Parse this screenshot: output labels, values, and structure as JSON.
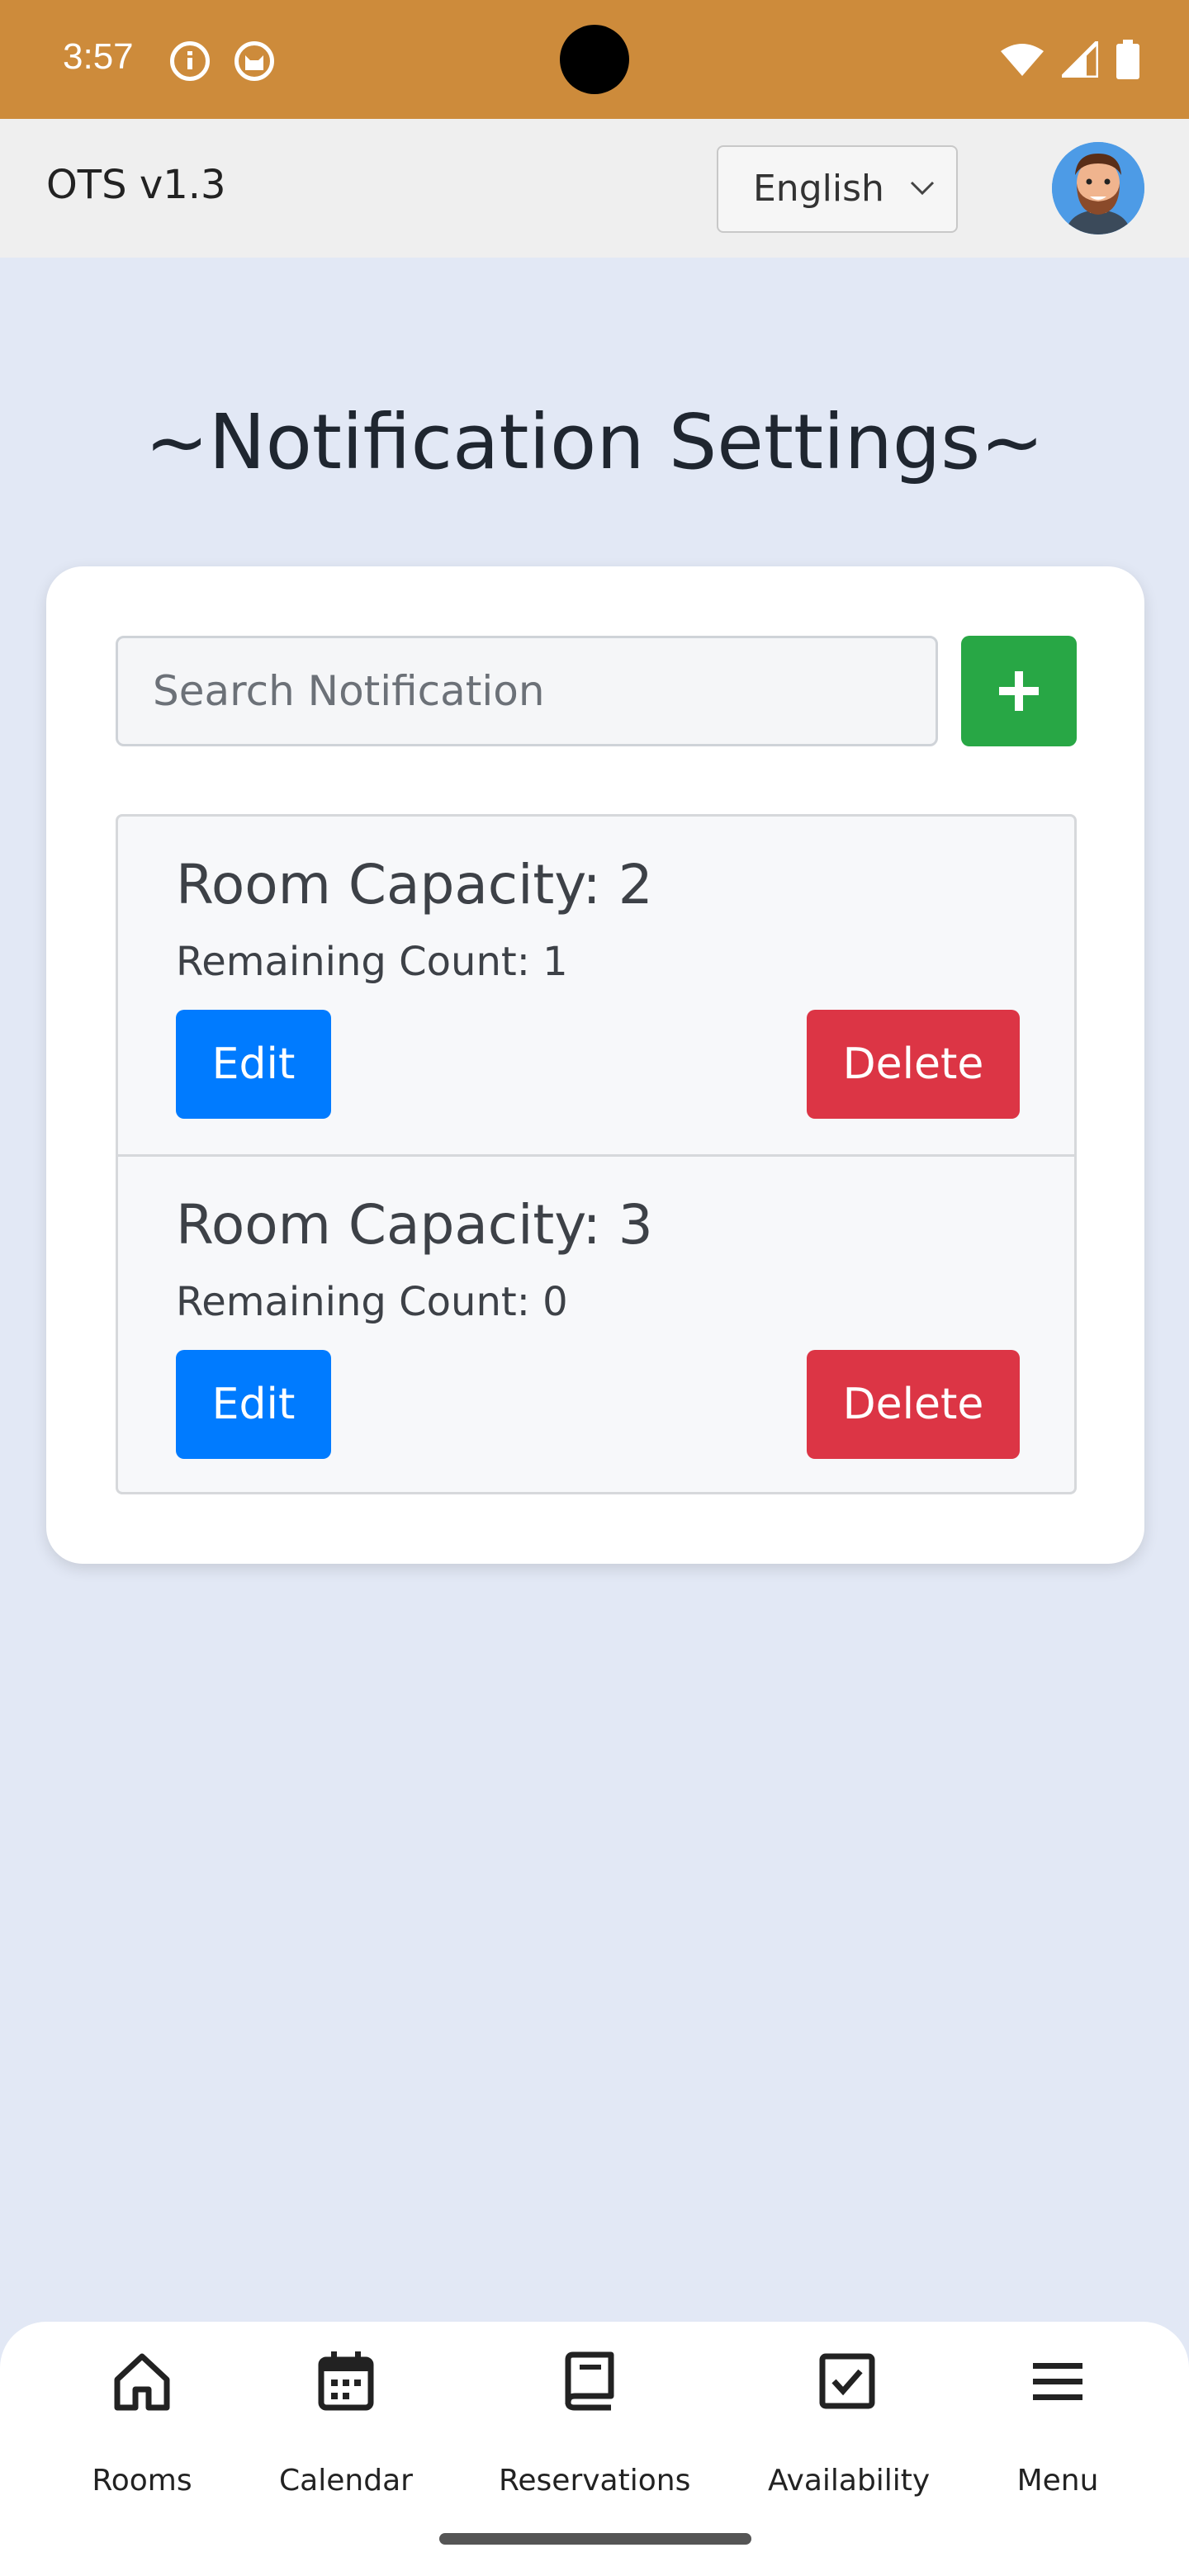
{
  "status_bar": {
    "time": "3:57",
    "icons": [
      "info-icon",
      "cat-icon"
    ],
    "right_icons": [
      "wifi-icon",
      "signal-icon",
      "battery-icon"
    ]
  },
  "header": {
    "app_title": "OTS v1.3",
    "language": "English",
    "avatar": "avatar"
  },
  "page": {
    "title": "~Notification Settings~"
  },
  "search": {
    "placeholder": "Search Notification",
    "add_icon": "plus-icon"
  },
  "notifications": [
    {
      "title": "Room Capacity: 2",
      "remaining": "Remaining Count: 1",
      "edit_label": "Edit",
      "delete_label": "Delete"
    },
    {
      "title": "Room Capacity: 3",
      "remaining": "Remaining Count: 0",
      "edit_label": "Edit",
      "delete_label": "Delete"
    }
  ],
  "nav": [
    {
      "label": "Rooms",
      "icon": "home-icon"
    },
    {
      "label": "Calendar",
      "icon": "calendar-icon"
    },
    {
      "label": "Reservations",
      "icon": "book-icon"
    },
    {
      "label": "Availability",
      "icon": "checkbox-icon"
    },
    {
      "label": "Menu",
      "icon": "menu-icon"
    }
  ],
  "colors": {
    "status_bar": "#cd8b3b",
    "background": "#e2e8f5",
    "add": "#28a745",
    "edit": "#007bff",
    "delete": "#dc3545"
  }
}
